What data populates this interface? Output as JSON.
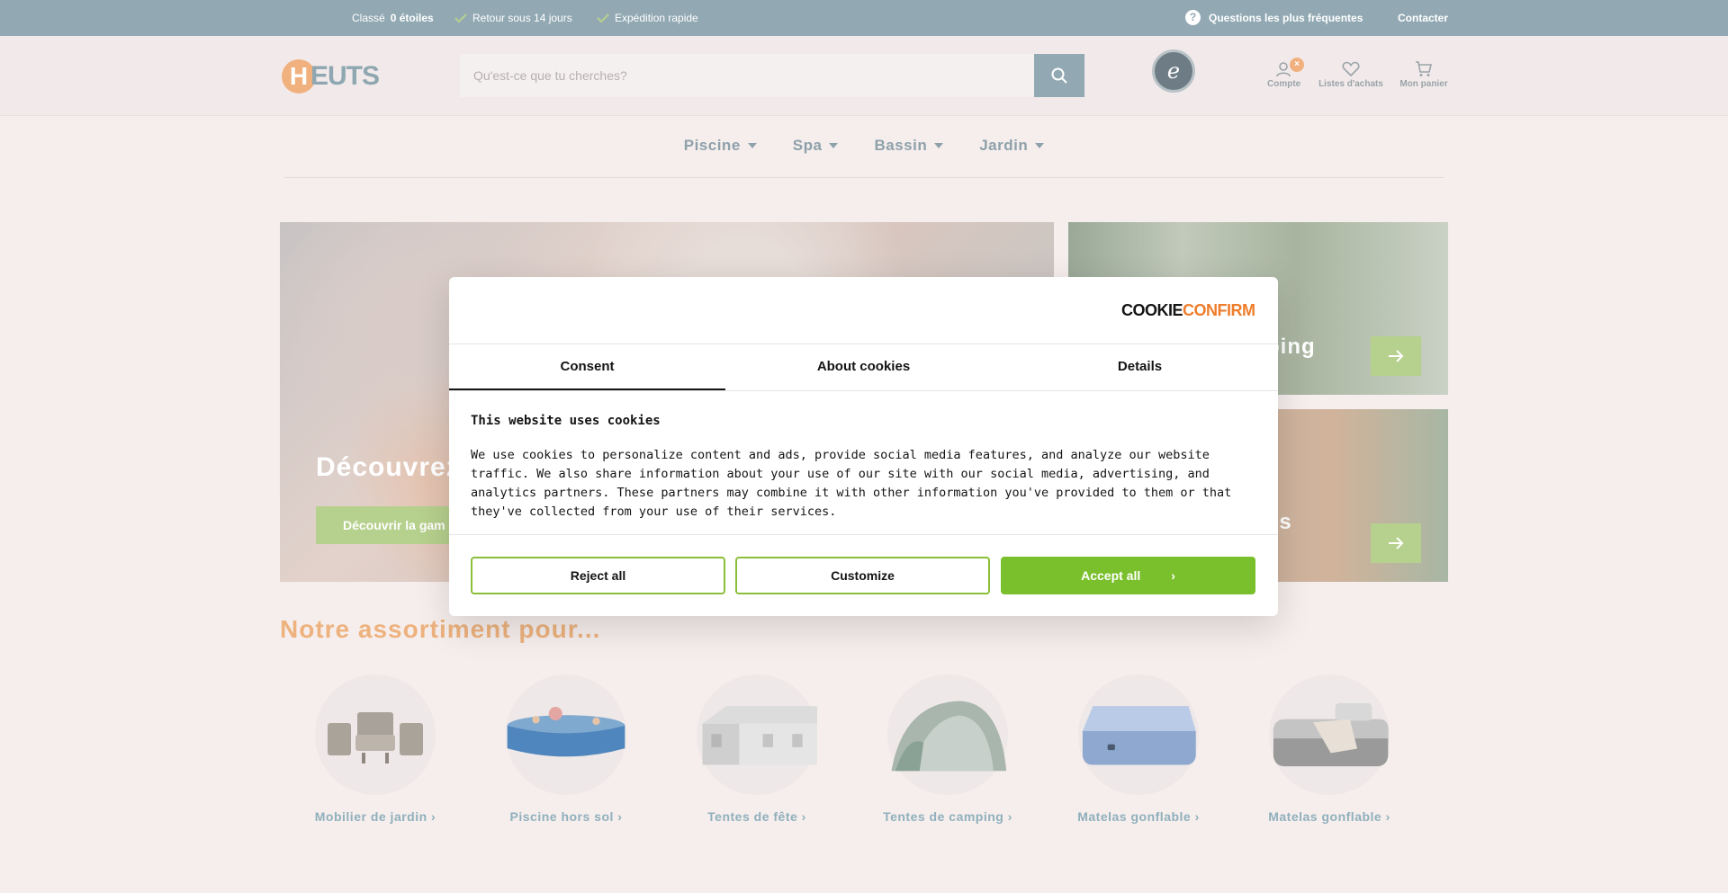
{
  "topbar": {
    "rating_prefix": "Classé",
    "rating_value": "0 étoiles",
    "usp_return": "Retour sous 14 jours",
    "usp_shipping": "Expédition rapide",
    "faq": "Questions les plus fréquentes",
    "contact": "Contacter"
  },
  "header": {
    "logo_letter": "H",
    "logo_text": "EUTS",
    "search_placeholder": "Qu'est-ce que tu cherches?",
    "account_label": "Compte",
    "account_badge": "×",
    "wishlist_label": "Listes d'achats",
    "cart_label": "Mon panier",
    "trusted_letter": "e"
  },
  "nav": {
    "items": [
      "Piscine",
      "Spa",
      "Bassin",
      "Jardin"
    ]
  },
  "hero": {
    "main_title": "Découvrez",
    "main_cta": "Découvrir la gam",
    "side_a_label": "ping",
    "side_b_label": "es"
  },
  "assortment": {
    "title": "Notre assortiment pour...",
    "categories": [
      {
        "name": "Mobilier de jardin ›",
        "icon": "garden-furniture-icon"
      },
      {
        "name": "Piscine hors sol ›",
        "icon": "above-ground-pool-icon"
      },
      {
        "name": "Tentes de fête ›",
        "icon": "party-tent-icon"
      },
      {
        "name": "Tentes de camping ›",
        "icon": "camping-tent-icon"
      },
      {
        "name": "Matelas gonflable ›",
        "icon": "air-mattress-icon"
      },
      {
        "name": "Matelas gonflable ›",
        "icon": "air-bed-icon"
      }
    ]
  },
  "cookie": {
    "brand_part1": "COOKIE",
    "brand_part2": "CONFIRM",
    "tabs": [
      "Consent",
      "About cookies",
      "Details"
    ],
    "heading": "This website uses cookies",
    "body": "We use cookies to personalize content and ads, provide social media features, and analyze our website traffic. We also share information about your use of our site with our social media, advertising, and analytics partners. These partners may combine it with other information you've provided to them or that they've collected from your use of their services.",
    "reject": "Reject all",
    "customize": "Customize",
    "accept": "Accept all",
    "accept_chevron": "›"
  },
  "colors": {
    "topbar": "#92a9b3",
    "accent_orange": "#edb27e",
    "accept_green": "#79c02c",
    "cta_green": "#b6d08d"
  }
}
